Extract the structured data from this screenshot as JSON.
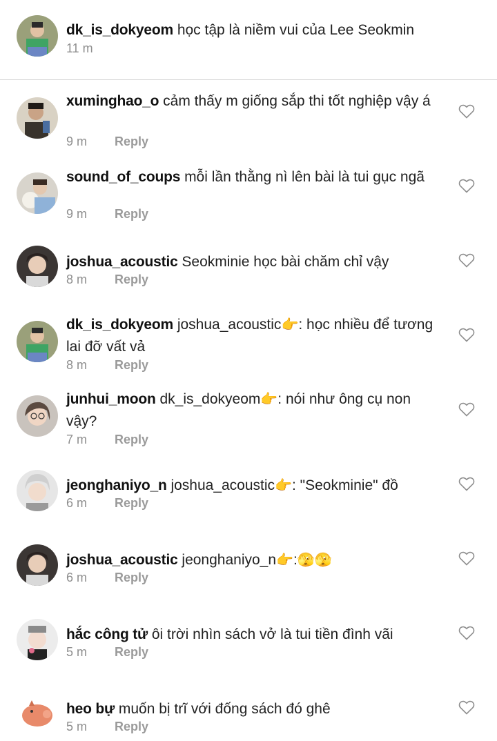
{
  "caption": {
    "username": "dk_is_dokyeom",
    "text": "học tập là niềm vui của Lee Seokmin",
    "time": "11 m"
  },
  "reply_label": "Reply",
  "comments": [
    {
      "username": "xuminghao_o",
      "text": "cảm thấy m giống sắp thi tốt nghiệp vậy á",
      "time": "9 m"
    },
    {
      "username": "sound_of_coups",
      "text": "mỗi lần thằng nì lên bài là tui gục ngã",
      "time": "9 m"
    },
    {
      "username": "joshua_acoustic",
      "text": "Seokminie học bài chăm chỉ vậy",
      "time": "8 m"
    },
    {
      "username": "dk_is_dokyeom",
      "mention": "joshua_acoustic",
      "emoji": "👉",
      "text": ": học nhiều để tương lai đỡ vất vả",
      "time": "8 m"
    },
    {
      "username": "junhui_moon",
      "mention": "dk_is_dokyeom",
      "emoji": "👉",
      "text": ": nói như ông cụ non vậy?",
      "time": "7 m"
    },
    {
      "username": "jeonghaniyo_n",
      "mention": "joshua_acoustic",
      "emoji": "👉",
      "text": ": \"Seokminie\" đồ",
      "time": "6 m"
    },
    {
      "username": "joshua_acoustic",
      "mention": "jeonghaniyo_n",
      "emoji": "👉",
      "text": ":",
      "emoji2": "🫣🫣",
      "time": "6 m"
    },
    {
      "username": "hắc công tử",
      "text": "ôi trời nhìn sách vở là tui tiền đình vãi",
      "time": "5 m"
    },
    {
      "username": "heo bự",
      "text": "muốn bị trĩ với đống sách đó ghê",
      "time": "5 m"
    }
  ],
  "colors": {
    "meta_gray": "#8e8e8e",
    "divider": "#d8d8d8",
    "heart_outline": "#8e8e8e"
  }
}
